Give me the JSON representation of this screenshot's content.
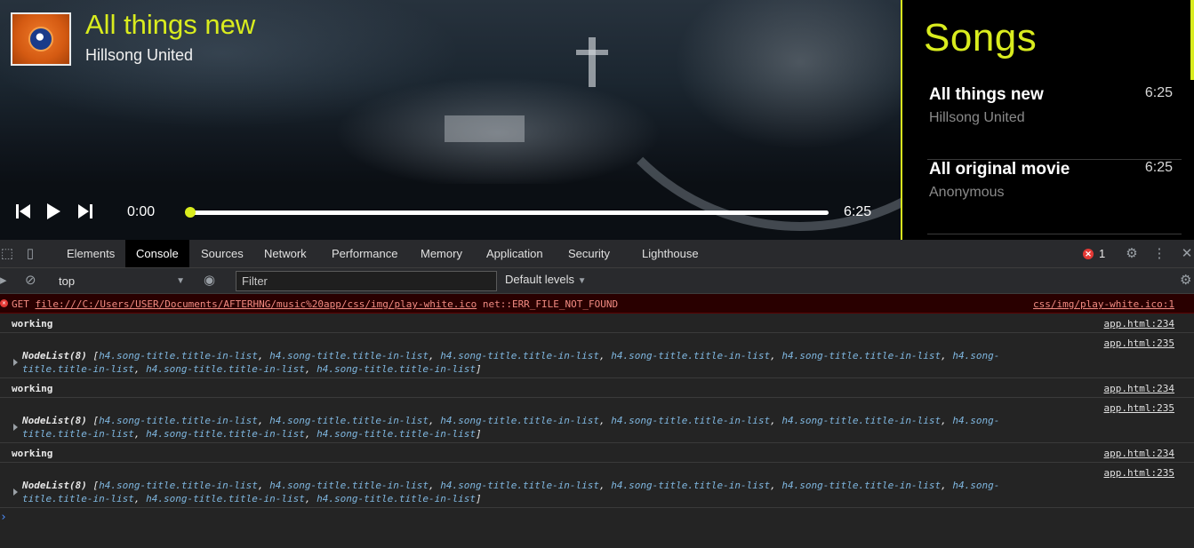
{
  "player": {
    "title": "All things new",
    "artist": "Hillsong United",
    "time_current": "0:00",
    "time_total": "6:25",
    "progress": 0
  },
  "songs_panel": {
    "heading": "Songs",
    "items": [
      {
        "title": "All things new",
        "artist": "Hillsong United",
        "duration": "6:25"
      },
      {
        "title": "All original movie",
        "artist": "Anonymous",
        "duration": "6:25"
      }
    ]
  },
  "devtools": {
    "tabs": [
      "Elements",
      "Console",
      "Sources",
      "Network",
      "Performance",
      "Memory",
      "Application",
      "Security",
      "Lighthouse"
    ],
    "active_tab": "Console",
    "error_count": "1",
    "context": "top",
    "filter_placeholder": "Filter",
    "levels_label": "Default levels",
    "console": {
      "error": {
        "method": "GET",
        "url": "file:///C:/Users/USER/Documents/AFTERHNG/music%20app/css/img/play-white.ico",
        "code": "net::ERR_FILE_NOT_FOUND",
        "source": "css/img/play-white.ico:1"
      },
      "log_text": "working",
      "log_source": "app.html:234",
      "nodelist_source": "app.html:235",
      "nodelist_head": "NodeList(8)",
      "nodelist_item": "h4.song-title.title-in-list"
    }
  },
  "colors": {
    "accent": "#d9ec1e",
    "error_bg": "#290000",
    "selector_blue": "#7fb7e0"
  }
}
